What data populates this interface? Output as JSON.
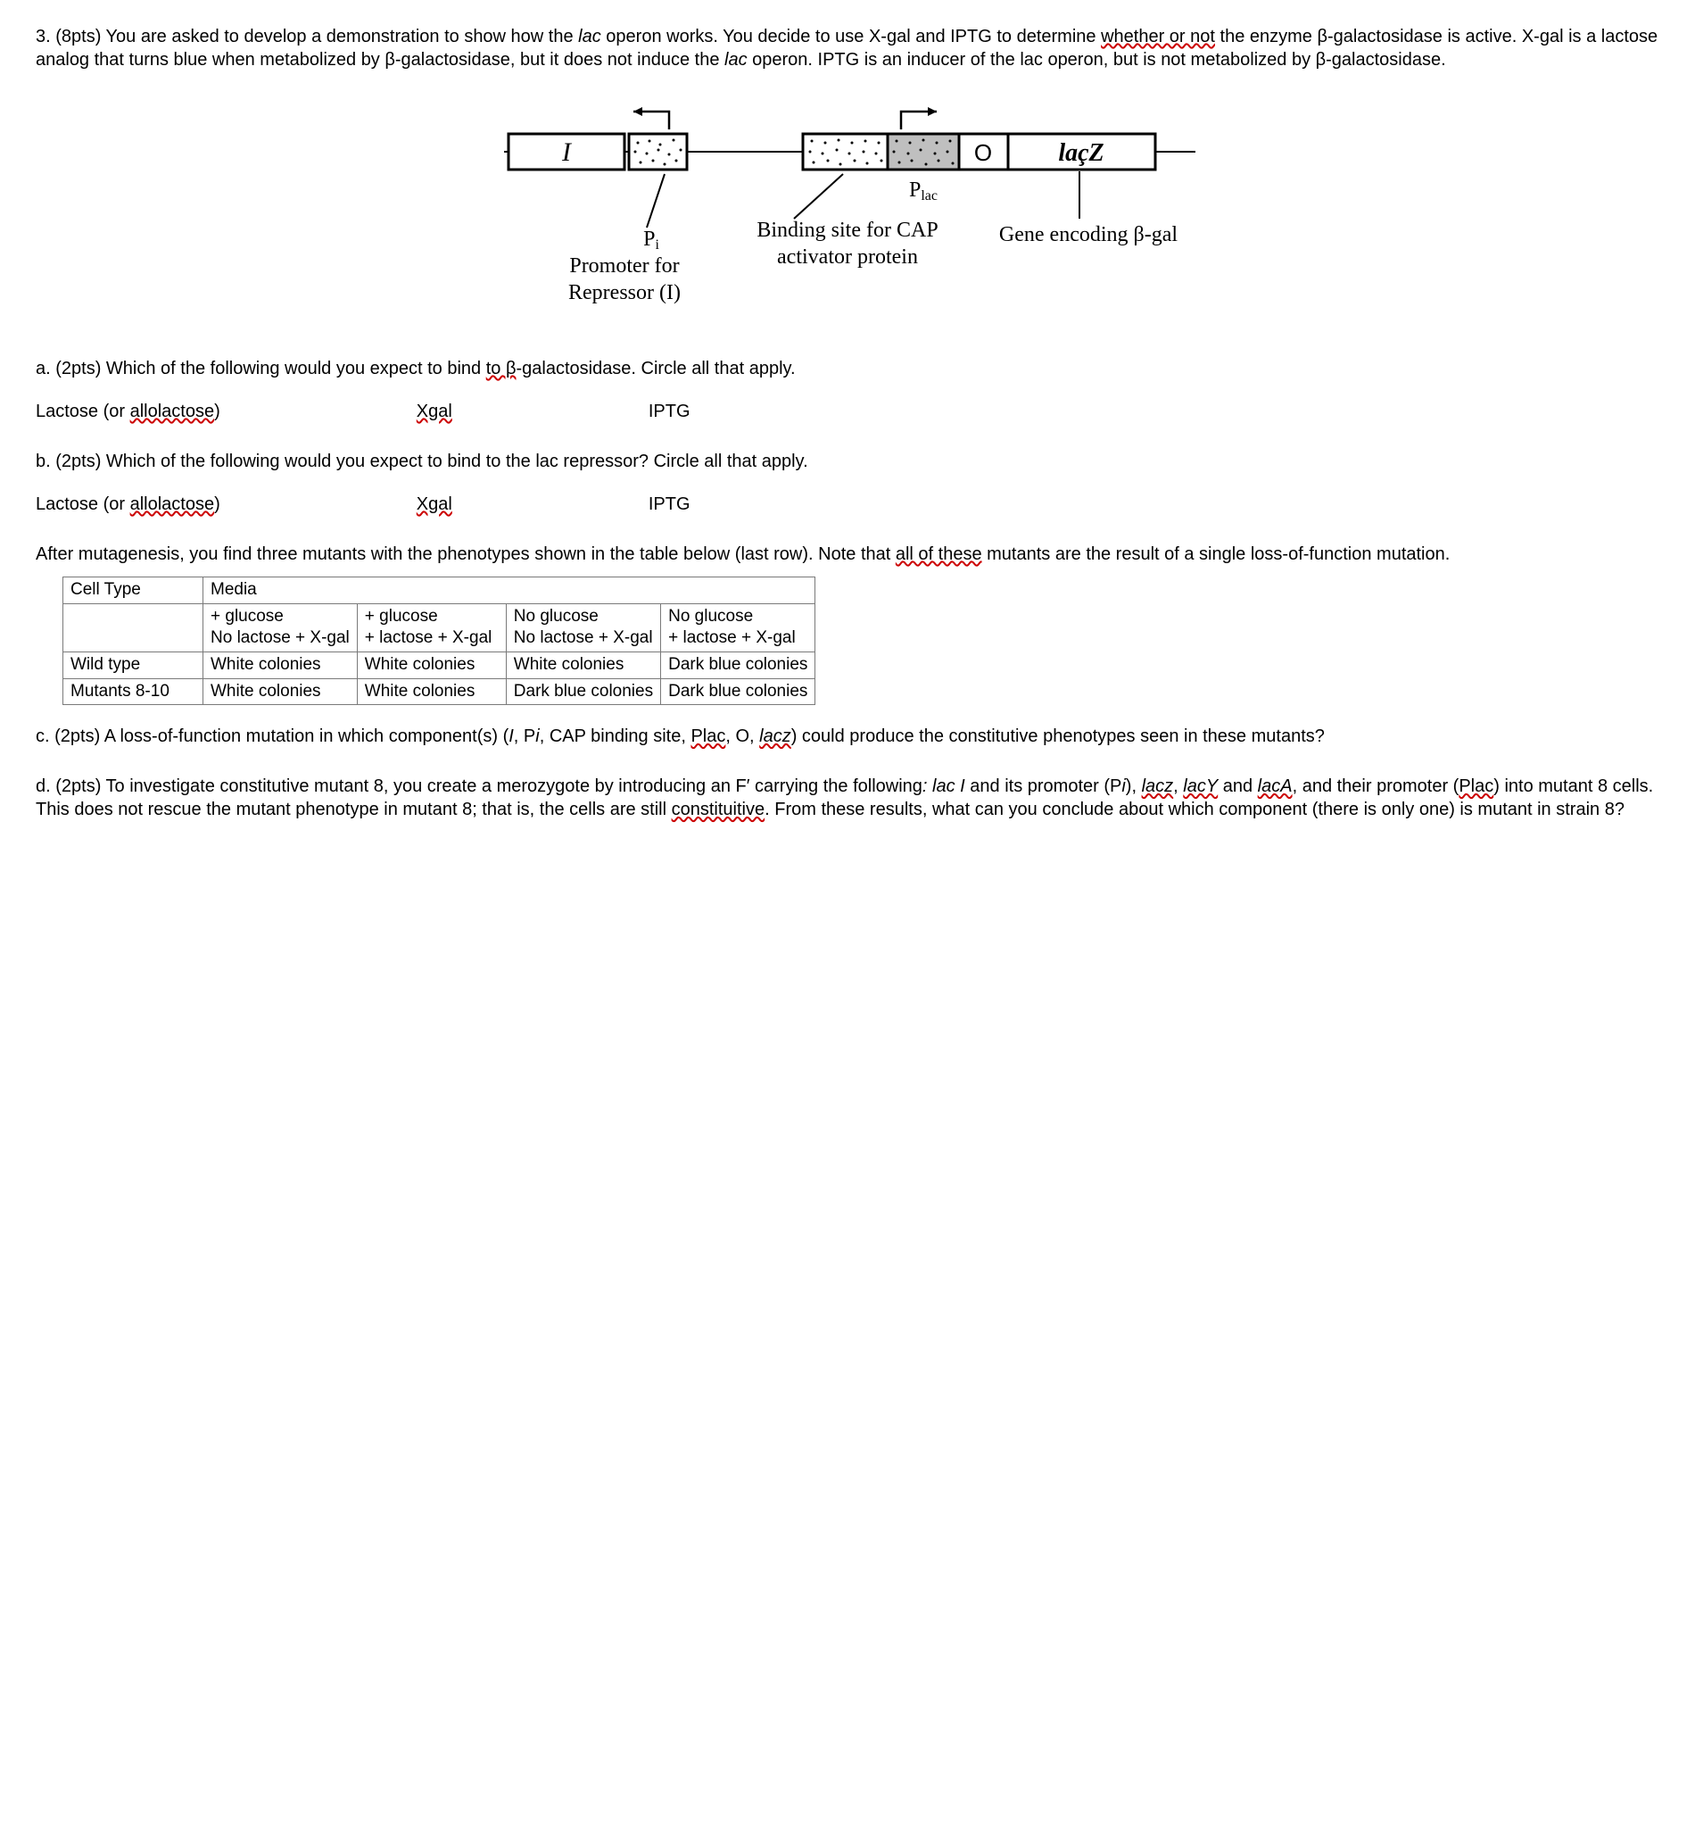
{
  "q_intro": "3. (8pts) You are asked to develop a demonstration to show how the ",
  "q_intro_italic1": "lac",
  "q_intro2": " operon works. You decide to use X-gal and IPTG to determine ",
  "q_intro_wavy": "whether or not",
  "q_intro3": " the enzyme β-galactosidase is active. X-gal is a lactose analog that turns blue when metabolized by β-galactosidase, but it does not induce the ",
  "q_intro_italic2": "lac",
  "q_intro4": " operon. IPTG is an inducer of the lac operon, but is not metabolized by β-galactosidase.",
  "diagram": {
    "I": "I",
    "O": "O",
    "lacZ": "laçZ",
    "Plac": "Plac",
    "Pi": "Pi",
    "promoter_label": "Promoter for\nRepressor (I)",
    "cap_label": "Binding site for CAP\nactivator protein",
    "gene_label": "Gene encoding β-gal"
  },
  "part_a": "a. (2pts) Which of the following would you expect to bind ",
  "part_a_wavy": "to β",
  "part_a2": "-galactosidase. Circle all that apply.",
  "choice1_pre": "Lactose (or ",
  "choice1_wavy": "allolactose",
  "choice1_post": ")",
  "choice2": "Xgal",
  "choice3": "IPTG",
  "part_b": "b. (2pts) Which of the following would you expect to bind to the lac repressor? Circle all that apply.",
  "after_mut1": "After mutagenesis, you find three mutants with the phenotypes shown in the table below (last row). Note that ",
  "after_mut_wavy": "all of these",
  "after_mut2": " mutants are the result of a single loss-of-function mutation.",
  "table": {
    "h_cell": "Cell Type",
    "h_media": "Media",
    "c1_l1": "+ glucose",
    "c1_l2": "No lactose + X-gal",
    "c2_l1": "+ glucose",
    "c2_l2": "+ lactose + X-gal",
    "c3_l1": "No glucose",
    "c3_l2": "No lactose + X-gal",
    "c4_l1": "No glucose",
    "c4_l2": "+ lactose + X-gal",
    "r_wt": "Wild type",
    "wt1": "White colonies",
    "wt2": "White colonies",
    "wt3": "White colonies",
    "wt4": "Dark blue colonies",
    "r_mut": "Mutants 8-10",
    "m1": "White colonies",
    "m2": "White colonies",
    "m3": "Dark blue colonies",
    "m4": "Dark blue colonies"
  },
  "part_c_pre": "c. (2pts) A loss-of-function mutation in which component(s) (",
  "part_c_I": "I",
  "part_c_mid1": ", P",
  "part_c_i": "i",
  "part_c_mid2": ", CAP binding site, ",
  "part_c_plac": "Plac",
  "part_c_mid3": ", O, ",
  "part_c_lacz": "lacz",
  "part_c_post": ") could produce the constitutive phenotypes seen in these mutants?",
  "part_d_pre": "d. (2pts) To investigate constitutive mutant 8, you create a merozygote by introducing an F′ carrying the following",
  "part_d_colon": ": ",
  "part_d_lacI": "lac I",
  "part_d_mid1": " and its promoter (P",
  "part_d_i": "i",
  "part_d_mid1b": "), ",
  "part_d_lacz": "lacz",
  "part_d_mid2": ", ",
  "part_d_lacy": "lacY",
  "part_d_mid3": " and ",
  "part_d_laca": "lacA",
  "part_d_mid4": ", and their promoter (",
  "part_d_plac": "Plac",
  "part_d_mid5": ") into mutant 8 cells. This does not rescue the mutant phenotype in mutant 8; that is, the cells are still ",
  "part_d_const": "constituitive",
  "part_d_post": ". From these results, what can you conclude about which component (there is only one) is mutant in strain 8?"
}
